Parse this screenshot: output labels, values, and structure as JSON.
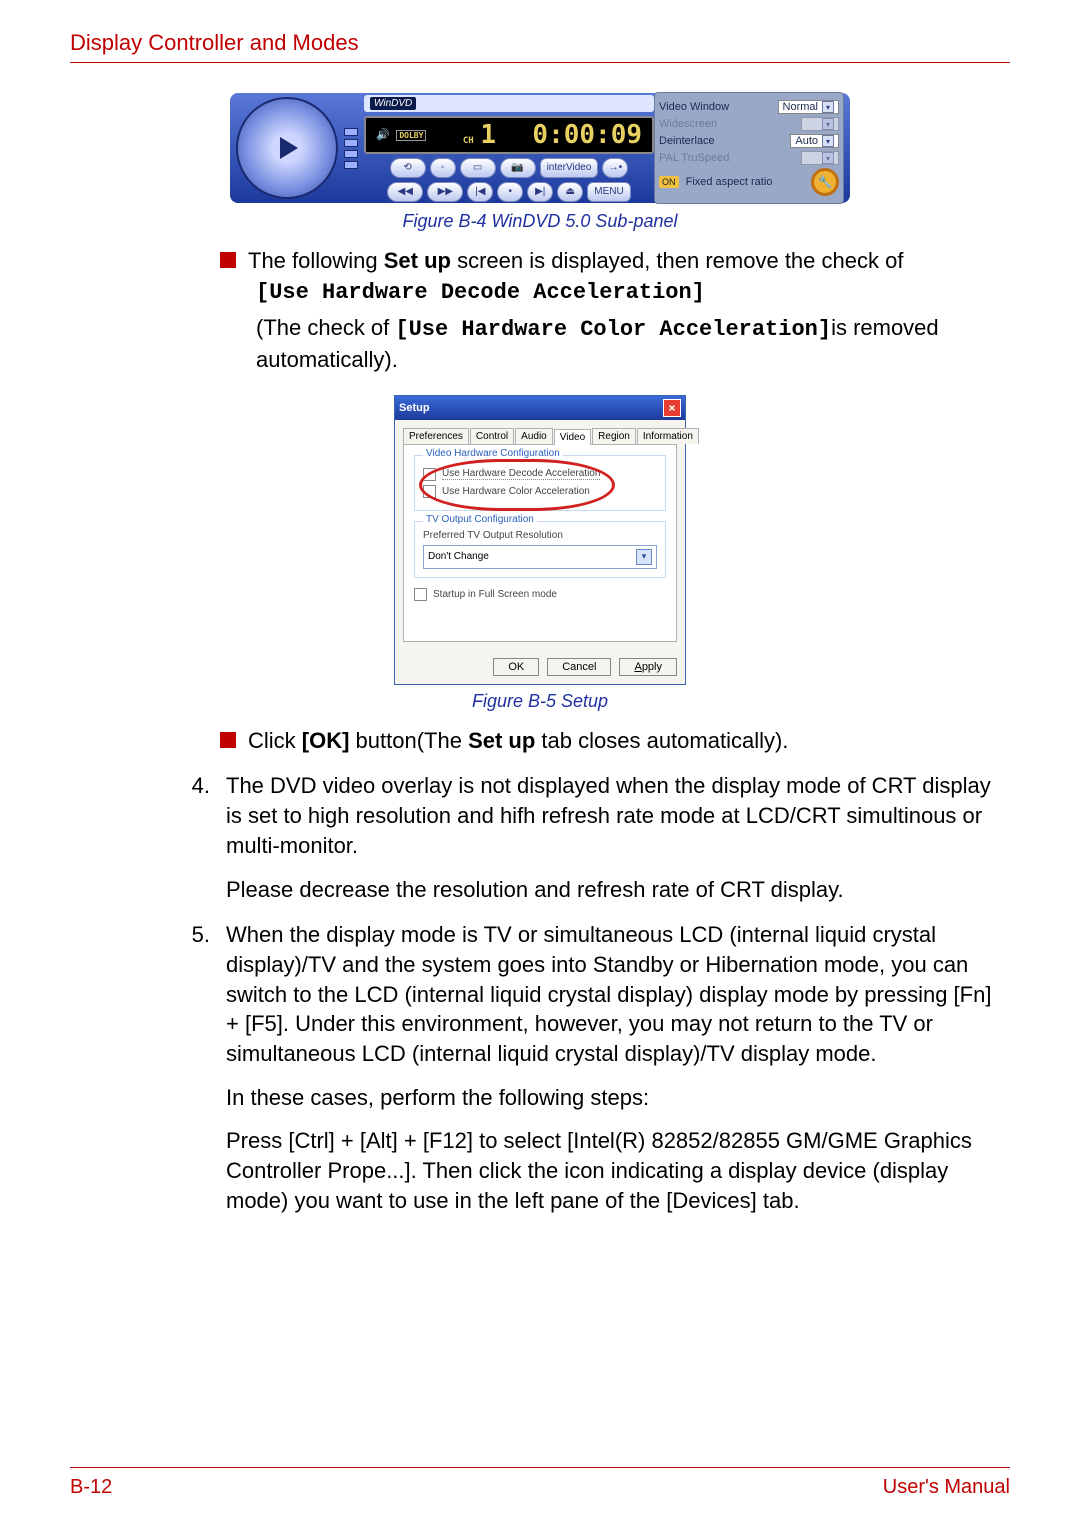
{
  "header": {
    "title": "Display Controller and Modes"
  },
  "footer": {
    "page": "B-12",
    "doc": "User's Manual"
  },
  "fig_b4": {
    "caption": "Figure B-4 WinDVD 5.0 Sub-panel",
    "logo": "WinDVD",
    "display": {
      "ch_label": "CH",
      "ch": "1",
      "time": "0:00:09"
    },
    "controls": {
      "menu": "MENU",
      "intervideo": "interVideo"
    },
    "side": {
      "videoWindowLabel": "Video Window",
      "videoWindowValue": "Normal",
      "widescreenLabel": "Widescreen",
      "deinterlaceLabel": "Deinterlace",
      "deinterlaceValue": "Auto",
      "palLabel": "PAL TruSpeed",
      "on": "ON",
      "fixedAspect": "Fixed aspect ratio"
    }
  },
  "fig_b5": {
    "caption": "Figure B-5 Setup",
    "title": "Setup",
    "tabs": [
      "Preferences",
      "Control",
      "Audio",
      "Video",
      "Region",
      "Information"
    ],
    "group1": {
      "legend": "Video Hardware Configuration",
      "check1": "Use Hardware Decode Acceleration",
      "check2": "Use Hardware Color Acceleration"
    },
    "group2": {
      "legend": "TV Output Configuration",
      "preflabel": "Preferred TV Output Resolution",
      "select": "Don't Change"
    },
    "check3": "Startup in Full Screen mode",
    "btns": {
      "ok": "OK",
      "cancel": "Cancel",
      "apply": "Apply"
    }
  },
  "text": {
    "bullet1a": "The following ",
    "bullet1b": "Set up",
    "bullet1c": " screen is displayed, then remove the check of",
    "bracket1": "[Use Hardware Decode Acceleration]",
    "line2a": "(The check of ",
    "line2b": "[Use Hardware Color Acceleration]",
    "line2c": "is removed automatically).",
    "bullet2a": "Click ",
    "bullet2b": "[OK]",
    "bullet2c": " button(The ",
    "bullet2d": "Set up",
    "bullet2e": " tab closes automatically).",
    "n4": "4.",
    "p4": "The DVD video overlay is not displayed when the display mode of CRT display is set to high resolution and hifh refresh rate mode at LCD/CRT simultinous or multi-monitor.",
    "p4b": "Please decrease the resolution and refresh rate of CRT display.",
    "n5": "5.",
    "p5": "When the display mode is TV or simultaneous LCD (internal liquid crystal display)/TV and the system goes into Standby or Hibernation mode, you can switch to the LCD (internal liquid crystal display) display mode by pressing [Fn] + [F5]. Under this environment, however, you may not return to the TV or simultaneous LCD (internal liquid crystal display)/TV display mode.",
    "p5b": "In these cases, perform the following steps:",
    "p5c": "Press [Ctrl] + [Alt] + [F12] to select [Intel(R) 82852/82855 GM/GME Graphics Controller Prope...]. Then click the icon indicating a display device (display mode) you want to use in the left pane of the [Devices] tab."
  }
}
